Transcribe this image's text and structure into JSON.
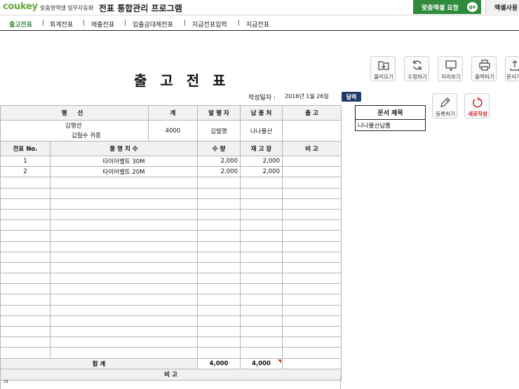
{
  "header": {
    "logo": "coukey",
    "logo_sub": "맞춤형엑셀 업무자동화",
    "title": "전표 통합관리 프로그램",
    "request_btn": "맞춤엑셀 요청",
    "go_badge": "go",
    "usage_btn": "엑셀사용"
  },
  "nav": [
    "출고전표",
    "회계전표",
    "매출전표",
    "입출금대체전표",
    "지급전표입력",
    "지급전표"
  ],
  "nav_active": 0,
  "doc": {
    "title": "출 고 전 표",
    "date_label": "작성일자 :",
    "date_value": "2016년 1월 26일",
    "calendar_btn": "달력"
  },
  "tools": {
    "load": "불러오기",
    "edit": "수정하기",
    "preview": "미리보기",
    "print": "출력하기",
    "docs": "문서가",
    "register": "등록하기",
    "new": "새로작성"
  },
  "docname": {
    "header": "문서 제목",
    "value": "나나물산납품"
  },
  "sheet": {
    "head1": {
      "recipient": "행            선",
      "total": "계",
      "issuer": "발 행 자",
      "supplier": "납 품 처",
      "release": "출    고"
    },
    "recipient_line1": "김행선",
    "recipient_line2": "김철수      귀중",
    "total_value": "4000",
    "issuer_value": "김발행",
    "supplier_value": "나나물산",
    "head2": {
      "no": "전표 No.",
      "item": "품 명 치 수",
      "qty": "수  량",
      "stock": "재 고 장",
      "note": "비    고"
    },
    "rows": [
      {
        "no": "1",
        "item": "타이어벨트 30M",
        "qty": "2,000",
        "stock": "2,000",
        "note": ""
      },
      {
        "no": "2",
        "item": "타이어벨트 20M",
        "qty": "2,000",
        "stock": "2,000",
        "note": ""
      }
    ],
    "sum_label": "합                계",
    "sum_qty": "4,000",
    "sum_stock": "4,000",
    "memo_label": "비                    고",
    "memo_value": "ㅁ"
  }
}
